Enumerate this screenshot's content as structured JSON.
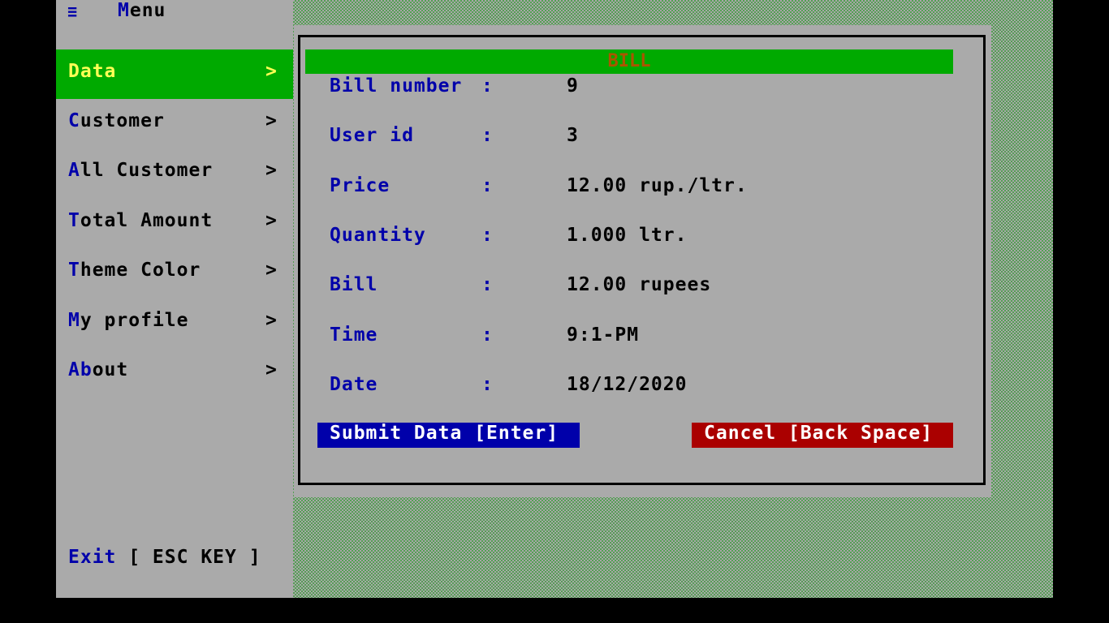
{
  "menu": {
    "icon": "≡",
    "icon_name": "hamburger-menu-icon",
    "title_hotkey": "M",
    "title_rest": "enu"
  },
  "sidebar": {
    "items": [
      {
        "hotkey": "D",
        "rest": "ata",
        "chevron": ">",
        "active": true
      },
      {
        "hotkey": "C",
        "rest": "ustomer",
        "chevron": ">",
        "active": false
      },
      {
        "hotkey": "A",
        "rest": "ll Customer",
        "chevron": ">",
        "active": false
      },
      {
        "hotkey": "T",
        "rest": "otal Amount",
        "chevron": ">",
        "active": false
      },
      {
        "hotkey": "T",
        "rest": "heme Color",
        "chevron": ">",
        "active": false
      },
      {
        "hotkey": "M",
        "rest": "y profile",
        "chevron": ">",
        "active": false
      },
      {
        "hotkey": "Ab",
        "rest": "out",
        "chevron": ">",
        "active": false
      }
    ],
    "exit": {
      "hotkey": "Exit",
      "rest": " [ ESC KEY ]"
    }
  },
  "panel": {
    "title": "BILL",
    "rows": [
      {
        "label": "Bill number",
        "colon": ":",
        "value": "9"
      },
      {
        "label": "User id",
        "colon": ":",
        "value": "3"
      },
      {
        "label": "Price",
        "colon": ":",
        "value": "12.00 rup./ltr."
      },
      {
        "label": "Quantity",
        "colon": ":",
        "value": "1.000 ltr."
      },
      {
        "label": "Bill",
        "colon": ":",
        "value": "12.00 rupees"
      },
      {
        "label": "Time",
        "colon": ":",
        "value": "9:1-PM"
      },
      {
        "label": "Date",
        "colon": ":",
        "value": "18/12/2020"
      }
    ],
    "submit_label": "Submit Data [Enter]",
    "cancel_label": "Cancel [Back Space]"
  },
  "colors": {
    "background_dither": "#00aa00",
    "sidebar_bg": "#aaaaaa",
    "active_item_bg": "#00aa00",
    "active_item_text": "#ffff55",
    "hotkey_text": "#0000aa",
    "title_bar_bg": "#00aa00",
    "title_text": "#aa5500",
    "submit_bg": "#0000aa",
    "cancel_bg": "#aa0000"
  }
}
